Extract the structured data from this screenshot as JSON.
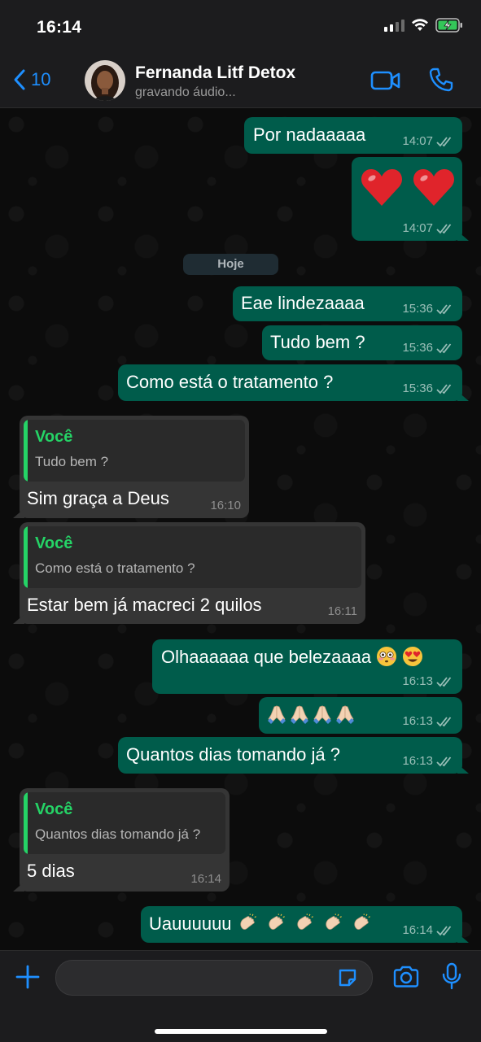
{
  "status_bar": {
    "time": "16:14"
  },
  "header": {
    "back_count": "10",
    "contact_name": "Fernanda Litf Detox",
    "contact_status": "gravando áudio..."
  },
  "day_chip": "Hoje",
  "messages": [
    {
      "dir": "out",
      "text": "Por nadaaaaa",
      "time": "14:07"
    },
    {
      "dir": "out",
      "text": "❤️❤️",
      "time": "14:07"
    },
    {
      "dir": "out",
      "text": "Eae lindezaaaa",
      "time": "15:36"
    },
    {
      "dir": "out",
      "text": "Tudo bem ?",
      "time": "15:36"
    },
    {
      "dir": "out",
      "text": "Como está o tratamento ?",
      "time": "15:36"
    },
    {
      "dir": "in",
      "quote_author": "Você",
      "quote_text": "Tudo bem ?",
      "text": "Sim graça a Deus",
      "time": "16:10"
    },
    {
      "dir": "in",
      "quote_author": "Você",
      "quote_text": "Como está o tratamento ?",
      "text": "Estar bem já macreci 2 quilos",
      "time": "16:11"
    },
    {
      "dir": "out",
      "text": "Olhaaaaaa que belezaaaa😳😍",
      "time": "16:13"
    },
    {
      "dir": "out",
      "text": "🙏🏻🙏🏻🙏🏻🙏🏻",
      "time": "16:13"
    },
    {
      "dir": "out",
      "text": "Quantos dias tomando já ?",
      "time": "16:13"
    },
    {
      "dir": "in",
      "quote_author": "Você",
      "quote_text": "Quantos dias tomando já ?",
      "text": "5 dias",
      "time": "16:14"
    },
    {
      "dir": "out",
      "text": "Uauuuuuu👏🏻👏🏻👏🏻👏🏻👏🏻",
      "time": "16:14"
    }
  ],
  "message_texts": {
    "m0": "Por nadaaaaa",
    "m2": "Eae lindezaaaa",
    "m3": "Tudo bem ?",
    "m4": "Como está o tratamento ?",
    "m5": "Sim graça a Deus",
    "m6": "Estar bem já macreci 2 quilos",
    "m7": "Olhaaaaaa que belezaaaa",
    "m9": "Quantos dias tomando já ?",
    "m10": "5 dias",
    "m11": "Uauuuuuu"
  },
  "colors": {
    "outgoing_bubble": "#005c4b",
    "incoming_bubble": "#353535",
    "accent_blue": "#1e8fff",
    "quote_green": "#25d366"
  },
  "icons": [
    "back-chevron-icon",
    "video-call-icon",
    "phone-icon",
    "read-receipt-icon",
    "plus-icon",
    "sticker-icon",
    "camera-icon",
    "microphone-icon"
  ]
}
